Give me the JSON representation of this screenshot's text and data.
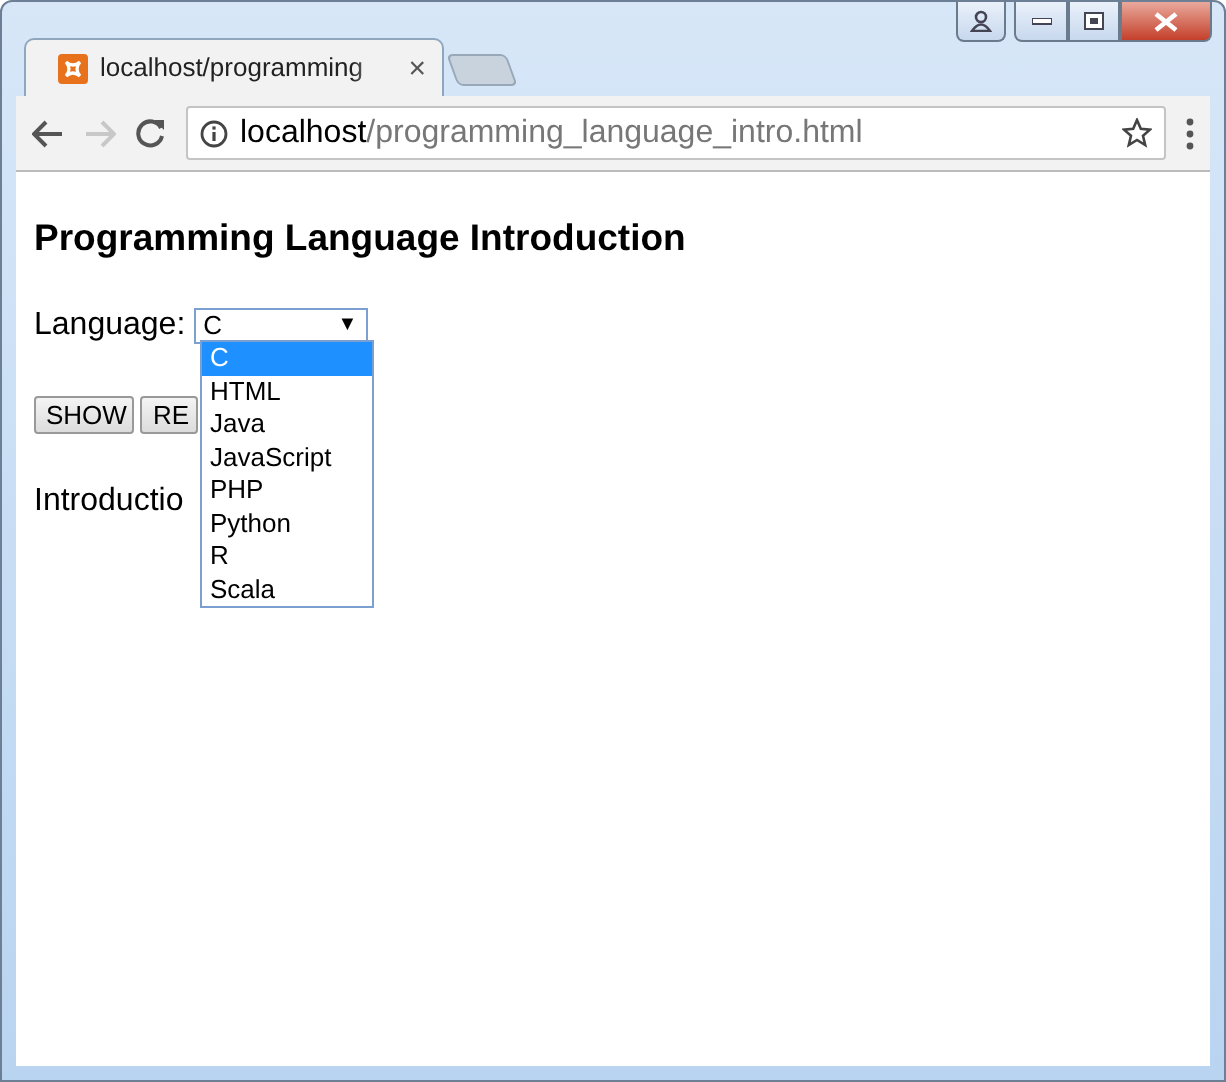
{
  "window": {
    "tab": {
      "title": "localhost/programming",
      "close": "×"
    },
    "address_bar": {
      "host": "localhost",
      "path": "/programming_language_intro.html"
    }
  },
  "page": {
    "heading": "Programming Language Introduction",
    "field_label": "Language:",
    "select": {
      "value": "C",
      "caret": "▼",
      "expanded": true,
      "options": [
        {
          "label": "C",
          "selected": true
        },
        {
          "label": "HTML",
          "selected": false
        },
        {
          "label": "Java",
          "selected": false
        },
        {
          "label": "JavaScript",
          "selected": false
        },
        {
          "label": "PHP",
          "selected": false
        },
        {
          "label": "Python",
          "selected": false
        },
        {
          "label": "R",
          "selected": false
        },
        {
          "label": "Scala",
          "selected": false
        }
      ]
    },
    "buttons": [
      "SHOW",
      "RE"
    ],
    "introduction_label": "Introductio"
  }
}
